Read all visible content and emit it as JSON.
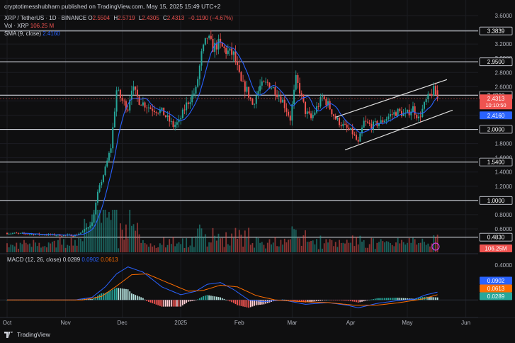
{
  "header": {
    "publisher": "cryptotimesshubham published on TradingView.com, May 15, 2025 15:49 UTC+2",
    "symbol": "XRP / TetherUS · 1D · BINANCE",
    "o_label": "O",
    "o_value": "2.5504",
    "h_label": "H",
    "h_value": "2.5719",
    "l_label": "L",
    "l_value": "2.4305",
    "c_label": "C",
    "c_value": "2.4313",
    "change": "−0.1190 (−4.67%)",
    "vol_label": "Vol · XRP",
    "vol_value": "106.25 M",
    "sma_label": "SMA (9, close)",
    "sma_value": "2.4160",
    "macd_label": "MACD (12, 26, close)",
    "macd_hist": "0.0289",
    "macd_line": "0.0902",
    "macd_signal": "0.0613"
  },
  "branding": {
    "name": "TradingView"
  },
  "colors": {
    "up": "#26a69a",
    "down": "#ef5350",
    "sma": "#2962ff",
    "macd": "#2962ff",
    "signal": "#ff6d00",
    "levels": "#d1d4dc",
    "channel": "#e0e0e0"
  },
  "chart_data": [
    {
      "type": "candlestick",
      "price_axis_ticks": [
        "3.6000",
        "3.4000",
        "3.2000",
        "3.0000",
        "2.8000",
        "2.6000",
        "2.4000",
        "2.2000",
        "2.0000",
        "1.8000",
        "1.6000",
        "1.4000",
        "1.2000",
        "1.0000",
        "0.8000",
        "0.6000"
      ],
      "ylim": [
        0.48,
        3.6
      ],
      "x_axis_labels": [
        {
          "label": "Oct",
          "day": 0
        },
        {
          "label": "Nov",
          "day": 31
        },
        {
          "label": "Dec",
          "day": 61
        },
        {
          "label": "2025",
          "day": 92
        },
        {
          "label": "Feb",
          "day": 123
        },
        {
          "label": "Mar",
          "day": 151
        },
        {
          "label": "Apr",
          "day": 182
        },
        {
          "label": "May",
          "day": 212
        },
        {
          "label": "Jun",
          "day": 243
        }
      ],
      "key_levels": [
        {
          "label": "3.3839",
          "value": 3.3839
        },
        {
          "label": "2.9500",
          "value": 2.95
        },
        {
          "label": "2.4800",
          "value": 2.48
        },
        {
          "label": "2.0000",
          "value": 2.0
        },
        {
          "label": "1.5400",
          "value": 1.54
        },
        {
          "label": "1.0000",
          "value": 1.0
        },
        {
          "label": "0.4830",
          "value": 0.483
        }
      ],
      "price_badges": [
        {
          "label": "2.4313",
          "sublabel": "10:10:50",
          "value": 2.4313,
          "color": "#ef5350"
        },
        {
          "label": "2.4160",
          "value": 2.416,
          "color": "#2962ff"
        }
      ],
      "volume_badge": {
        "label": "106.25M",
        "color": "#ef5350"
      },
      "channel": {
        "upper": [
          {
            "day": 174,
            "price": 2.17
          },
          {
            "day": 233,
            "price": 2.7
          }
        ],
        "lower": [
          {
            "day": 179,
            "price": 1.71
          },
          {
            "day": 236,
            "price": 2.27
          }
        ]
      },
      "close_anchors": [
        {
          "day": 0,
          "close": 0.54
        },
        {
          "day": 10,
          "close": 0.53
        },
        {
          "day": 20,
          "close": 0.52
        },
        {
          "day": 30,
          "close": 0.51
        },
        {
          "day": 36,
          "close": 0.51
        },
        {
          "day": 40,
          "close": 0.56
        },
        {
          "day": 45,
          "close": 0.68
        },
        {
          "day": 48,
          "close": 1.1
        },
        {
          "day": 52,
          "close": 1.45
        },
        {
          "day": 55,
          "close": 1.75
        },
        {
          "day": 58,
          "close": 2.55
        },
        {
          "day": 61,
          "close": 2.4
        },
        {
          "day": 64,
          "close": 2.3
        },
        {
          "day": 66,
          "close": 2.6
        },
        {
          "day": 70,
          "close": 2.4
        },
        {
          "day": 76,
          "close": 2.3
        },
        {
          "day": 82,
          "close": 2.25
        },
        {
          "day": 88,
          "close": 2.05
        },
        {
          "day": 91,
          "close": 2.1
        },
        {
          "day": 95,
          "close": 2.35
        },
        {
          "day": 100,
          "close": 2.55
        },
        {
          "day": 103,
          "close": 3.05
        },
        {
          "day": 106,
          "close": 3.3
        },
        {
          "day": 109,
          "close": 3.15
        },
        {
          "day": 112,
          "close": 3.2
        },
        {
          "day": 116,
          "close": 3.1
        },
        {
          "day": 120,
          "close": 3.05
        },
        {
          "day": 124,
          "close": 2.65
        },
        {
          "day": 127,
          "close": 2.55
        },
        {
          "day": 130,
          "close": 2.35
        },
        {
          "day": 134,
          "close": 2.6
        },
        {
          "day": 138,
          "close": 2.65
        },
        {
          "day": 142,
          "close": 2.55
        },
        {
          "day": 146,
          "close": 2.4
        },
        {
          "day": 150,
          "close": 2.15
        },
        {
          "day": 153,
          "close": 2.7
        },
        {
          "day": 155,
          "close": 2.55
        },
        {
          "day": 158,
          "close": 2.25
        },
        {
          "day": 161,
          "close": 2.15
        },
        {
          "day": 164,
          "close": 2.3
        },
        {
          "day": 167,
          "close": 2.45
        },
        {
          "day": 170,
          "close": 2.35
        },
        {
          "day": 174,
          "close": 2.15
        },
        {
          "day": 178,
          "close": 2.05
        },
        {
          "day": 183,
          "close": 1.95
        },
        {
          "day": 186,
          "close": 1.8
        },
        {
          "day": 189,
          "close": 2.1
        },
        {
          "day": 193,
          "close": 2.05
        },
        {
          "day": 198,
          "close": 2.1
        },
        {
          "day": 203,
          "close": 2.2
        },
        {
          "day": 207,
          "close": 2.25
        },
        {
          "day": 211,
          "close": 2.2
        },
        {
          "day": 215,
          "close": 2.3
        },
        {
          "day": 218,
          "close": 2.15
        },
        {
          "day": 222,
          "close": 2.4
        },
        {
          "day": 226,
          "close": 2.55
        },
        {
          "day": 228,
          "close": 2.43
        }
      ]
    },
    {
      "type": "bar",
      "name": "Vol · XRP",
      "note": "daily volume bars aligned with price candles",
      "last_value": "106.25M"
    },
    {
      "type": "macd",
      "axis_ticks": [
        "0.4000",
        "0.2000"
      ],
      "ylim": [
        -0.12,
        0.45
      ],
      "macd_anchors": [
        {
          "day": 0,
          "v": 0.0
        },
        {
          "day": 36,
          "v": 0.0
        },
        {
          "day": 45,
          "v": 0.03
        },
        {
          "day": 52,
          "v": 0.15
        },
        {
          "day": 58,
          "v": 0.3
        },
        {
          "day": 64,
          "v": 0.38
        },
        {
          "day": 72,
          "v": 0.32
        },
        {
          "day": 82,
          "v": 0.15
        },
        {
          "day": 92,
          "v": 0.06
        },
        {
          "day": 100,
          "v": 0.1
        },
        {
          "day": 106,
          "v": 0.18
        },
        {
          "day": 113,
          "v": 0.2
        },
        {
          "day": 120,
          "v": 0.12
        },
        {
          "day": 128,
          "v": 0.0
        },
        {
          "day": 136,
          "v": -0.02
        },
        {
          "day": 146,
          "v": 0.0
        },
        {
          "day": 158,
          "v": -0.05
        },
        {
          "day": 170,
          "v": -0.03
        },
        {
          "day": 180,
          "v": -0.06
        },
        {
          "day": 186,
          "v": -0.09
        },
        {
          "day": 196,
          "v": -0.04
        },
        {
          "day": 206,
          "v": -0.01
        },
        {
          "day": 216,
          "v": 0.01
        },
        {
          "day": 222,
          "v": 0.06
        },
        {
          "day": 228,
          "v": 0.09
        }
      ],
      "signal_anchors": [
        {
          "day": 0,
          "v": 0.0
        },
        {
          "day": 40,
          "v": 0.0
        },
        {
          "day": 50,
          "v": 0.04
        },
        {
          "day": 58,
          "v": 0.16
        },
        {
          "day": 66,
          "v": 0.29
        },
        {
          "day": 74,
          "v": 0.3
        },
        {
          "day": 86,
          "v": 0.19
        },
        {
          "day": 96,
          "v": 0.1
        },
        {
          "day": 104,
          "v": 0.11
        },
        {
          "day": 113,
          "v": 0.17
        },
        {
          "day": 122,
          "v": 0.15
        },
        {
          "day": 132,
          "v": 0.05
        },
        {
          "day": 142,
          "v": 0.0
        },
        {
          "day": 156,
          "v": -0.02
        },
        {
          "day": 170,
          "v": -0.03
        },
        {
          "day": 184,
          "v": -0.06
        },
        {
          "day": 196,
          "v": -0.06
        },
        {
          "day": 208,
          "v": -0.03
        },
        {
          "day": 220,
          "v": 0.01
        },
        {
          "day": 228,
          "v": 0.061
        }
      ]
    }
  ]
}
